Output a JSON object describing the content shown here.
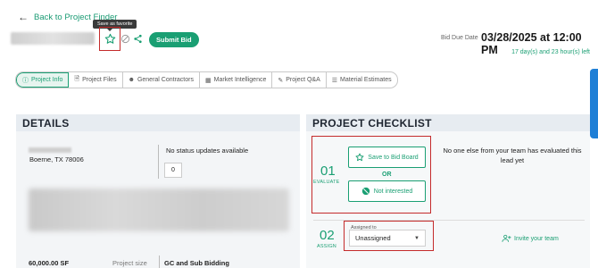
{
  "header": {
    "back_label": "Back to Project Finder",
    "favorite_tooltip": "Save as favorite",
    "submit_bid_label": "Submit Bid",
    "due_label": "Bid Due Date",
    "due_value": "03/28/2025 at 12:00 PM",
    "time_left": "17 day(s) and 23 hour(s) left"
  },
  "tabs": [
    {
      "label": "Project Info",
      "icon": "info-icon"
    },
    {
      "label": "Project Files",
      "icon": "file-icon"
    },
    {
      "label": "General Contractors",
      "icon": "user-icon"
    },
    {
      "label": "Market Intelligence",
      "icon": "chart-icon"
    },
    {
      "label": "Project Q&A",
      "icon": "chat-icon"
    },
    {
      "label": "Material Estimates",
      "icon": "document-icon"
    }
  ],
  "details": {
    "title": "DETAILS",
    "location": "Boerne, TX 78006",
    "status_text": "No status updates available",
    "status_count": "0",
    "size_value": "60,000.00 SF",
    "size_label": "Project size",
    "bidding_type": "GC and Sub Bidding"
  },
  "checklist": {
    "title": "PROJECT CHECKLIST",
    "step1_num": "01",
    "step1_label": "EVALUATE",
    "save_bid_board_label": "Save to Bid Board",
    "or_label": "OR",
    "not_interested_label": "Not interested",
    "eval_note": "No one else from your team has evaluated this lead yet",
    "step2_num": "02",
    "step2_label": "ASSIGN",
    "assigned_to_label": "Assigned to",
    "assigned_value": "Unassigned",
    "invite_label": "Invite your team"
  },
  "colors": {
    "accent": "#1a9f73",
    "highlight": "#c42b2b",
    "side_tab": "#1f7fd6"
  }
}
